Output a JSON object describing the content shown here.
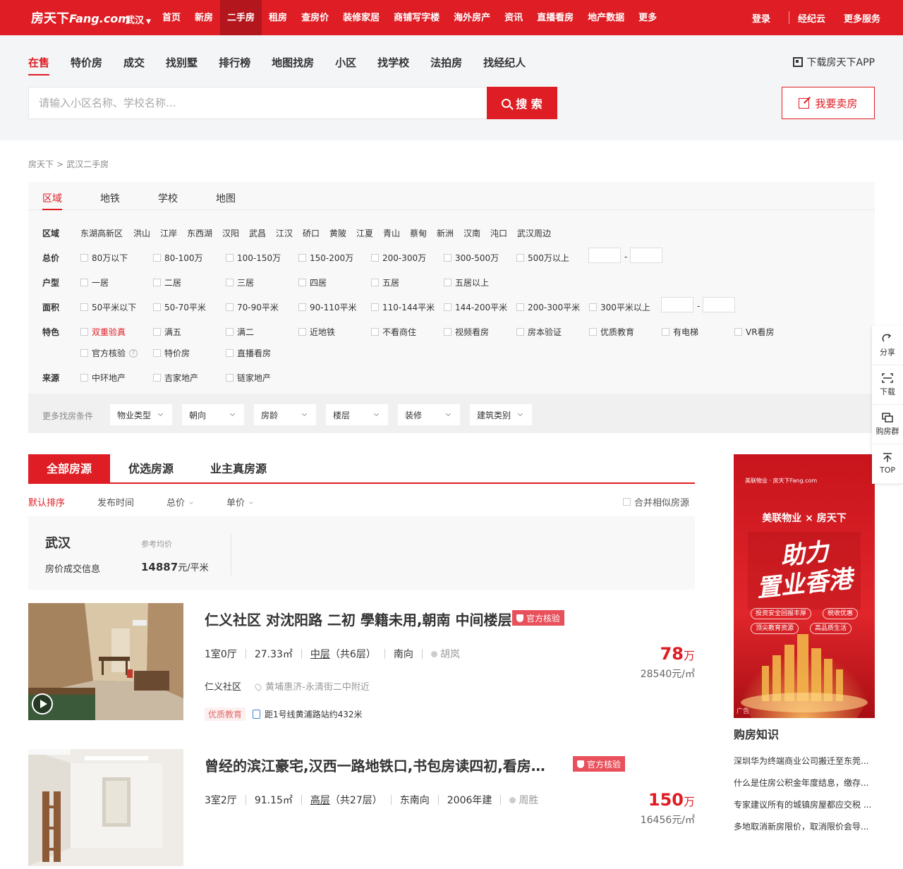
{
  "topbar": {
    "logo": "房天下",
    "logo_en": "Fang.com",
    "city": "武汉",
    "nav": [
      "首页",
      "新房",
      "二手房",
      "租房",
      "查房价",
      "装修家居",
      "商铺写字楼",
      "海外房产",
      "资讯",
      "直播看房",
      "地产数据",
      "更多"
    ],
    "active_nav": "二手房",
    "right": [
      "登录",
      "经纪云",
      "更多服务"
    ]
  },
  "searchbar": {
    "tabs": [
      "在售",
      "特价房",
      "成交",
      "找别墅",
      "排行榜",
      "地图找房",
      "小区",
      "找学校",
      "法拍房",
      "找经纪人"
    ],
    "active_tab": "在售",
    "download_app": "下载房天下APP",
    "placeholder": "请输入小区名称、学校名称...",
    "search_label": "搜 索",
    "sell_label": "我要卖房"
  },
  "breadcrumb": [
    "房天下",
    "武汉二手房"
  ],
  "filter": {
    "tabs": [
      "区域",
      "地铁",
      "学校",
      "地图"
    ],
    "active_tab": "区域",
    "region_label": "区域",
    "regions": [
      "东湖高新区",
      "洪山",
      "江岸",
      "东西湖",
      "汉阳",
      "武昌",
      "江汉",
      "硚口",
      "黄陂",
      "江夏",
      "青山",
      "蔡甸",
      "新洲",
      "汉南",
      "沌口",
      "武汉周边"
    ],
    "price_label": "总价",
    "prices": [
      "80万以下",
      "80-100万",
      "100-150万",
      "150-200万",
      "200-300万",
      "300-500万",
      "500万以上"
    ],
    "layout_label": "户型",
    "layouts": [
      "一居",
      "二居",
      "三居",
      "四居",
      "五居",
      "五居以上"
    ],
    "area_label": "面积",
    "areas": [
      "50平米以下",
      "50-70平米",
      "70-90平米",
      "90-110平米",
      "110-144平米",
      "144-200平米",
      "200-300平米",
      "300平米以上"
    ],
    "feature_label": "特色",
    "features": [
      "双重验真",
      "满五",
      "满二",
      "近地铁",
      "不看商住",
      "视频看房",
      "房本验证",
      "优质教育",
      "有电梯",
      "VR看房",
      "官方核验",
      "特价房",
      "直播看房"
    ],
    "source_label": "来源",
    "sources": [
      "中环地产",
      "吉家地产",
      "链家地产"
    ],
    "more_label": "更多找房条件",
    "more_dropdowns": [
      "物业类型",
      "朝向",
      "房龄",
      "楼层",
      "装修",
      "建筑类别"
    ]
  },
  "results": {
    "tabs": [
      "全部房源",
      "优选房源",
      "业主真房源"
    ],
    "active_tab": "全部房源",
    "sorts": [
      "默认排序",
      "发布时间",
      "总价",
      "单价"
    ],
    "active_sort": "默认排序",
    "merge_label": "合并相似房源"
  },
  "avg": {
    "city": "武汉",
    "info": "房价成交信息",
    "ref_label": "参考均价",
    "ref_value": "14887",
    "ref_unit": "元/平米"
  },
  "listings": [
    {
      "title": "仁义社区 对沈阳路 二初 學籍未用,朝南 中间楼层",
      "badge": "官方核验",
      "rooms": "1室0厅",
      "area": "27.33㎡",
      "floor": "中层",
      "floor_total": "（共6层）",
      "orientation": "南向",
      "year": "",
      "agent": "胡岚",
      "community": "仁义社区",
      "address": "黄埔惠济-永清街二中附近",
      "tag": "优质教育",
      "subway": "距1号线黄浦路站约432米",
      "price": "78",
      "price_unit": "万",
      "unit_price": "28540元/㎡",
      "has_video": true
    },
    {
      "title": "曾经的滨江豪宅,汉西一路地铁口,书包房读四初,看房方...",
      "badge": "官方核验",
      "rooms": "3室2厅",
      "area": "91.15㎡",
      "floor": "高层",
      "floor_total": "（共27层）",
      "orientation": "东南向",
      "year": "2006年建",
      "agent": "周胜",
      "community": "",
      "address": "",
      "tag": "",
      "subway": "",
      "price": "150",
      "price_unit": "万",
      "unit_price": "16456元/㎡",
      "has_video": false
    }
  ],
  "ad": {
    "brand": "美联物业 × 房天下",
    "logo_text": "美联物业 · 房天下Fang.com",
    "headline1": "助力",
    "headline2": "置业香港",
    "chips": [
      "投资安全回报丰厚",
      "税收优惠",
      "顶尖教育资源",
      "高品质生活"
    ],
    "label": "广告"
  },
  "knowledge": {
    "title": "购房知识",
    "items": [
      "深圳华为终端商业公司搬迁至东莞...",
      "什么是住房公积金年度结息，缴存...",
      "专家建议所有的城镇房屋都应交税 ...",
      "多地取消新房限价，取消限价会导..."
    ]
  },
  "sidebar": [
    "分享",
    "下载",
    "购房群",
    "TOP"
  ],
  "colors": {
    "brand": "#de1d24",
    "badge": "#e8505b",
    "price": "#de1d24"
  }
}
